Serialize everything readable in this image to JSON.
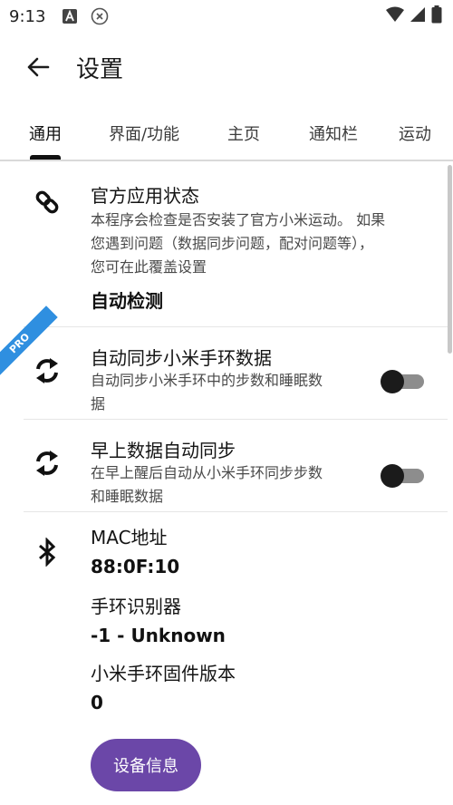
{
  "status_bar": {
    "time": "9:13",
    "icons": [
      "a-notification-icon",
      "x-notification-icon",
      "wifi-icon",
      "signal-icon",
      "battery-icon"
    ]
  },
  "app_bar": {
    "title": "设置",
    "back_icon": "arrow-back-icon"
  },
  "tabs": [
    {
      "label": "通用",
      "active": true
    },
    {
      "label": "界面/功能",
      "active": false
    },
    {
      "label": "主页",
      "active": false
    },
    {
      "label": "通知栏",
      "active": false
    },
    {
      "label": "运动",
      "active": false
    }
  ],
  "settings": {
    "official_app": {
      "icon": "link-icon",
      "title": "官方应用状态",
      "desc": [
        "本程序会检查是否安装了官方小米运动。 如果",
        "您遇到问题（数据同步问题，配对问题等），",
        "您可在此覆盖设置"
      ],
      "value": "自动检测"
    },
    "auto_sync": {
      "icon": "sync-icon",
      "badge": "PRO",
      "title": "自动同步小米手环数据",
      "desc": [
        "自动同步小米手环中的步数和睡眠数",
        "据"
      ],
      "enabled": false
    },
    "morning_sync": {
      "icon": "sync-icon",
      "title": "早上数据自动同步",
      "desc": [
        "在早上醒后自动从小米手环同步步数",
        "和睡眠数据"
      ],
      "enabled": false
    },
    "device": {
      "icon": "bluetooth-icon",
      "mac_label": "MAC地址",
      "mac_value": "88:0F:10",
      "band_id_label": "手环识别器",
      "band_id_value": "-1 - Unknown",
      "firmware_label": "小米手环固件版本",
      "firmware_value": "0",
      "device_info_button": "设备信息"
    }
  },
  "colors": {
    "accent": "#6b47a8",
    "pro_badge": "#2f8fe0",
    "switch_track": "#8d8d8d",
    "switch_thumb": "#1b1b1b"
  }
}
